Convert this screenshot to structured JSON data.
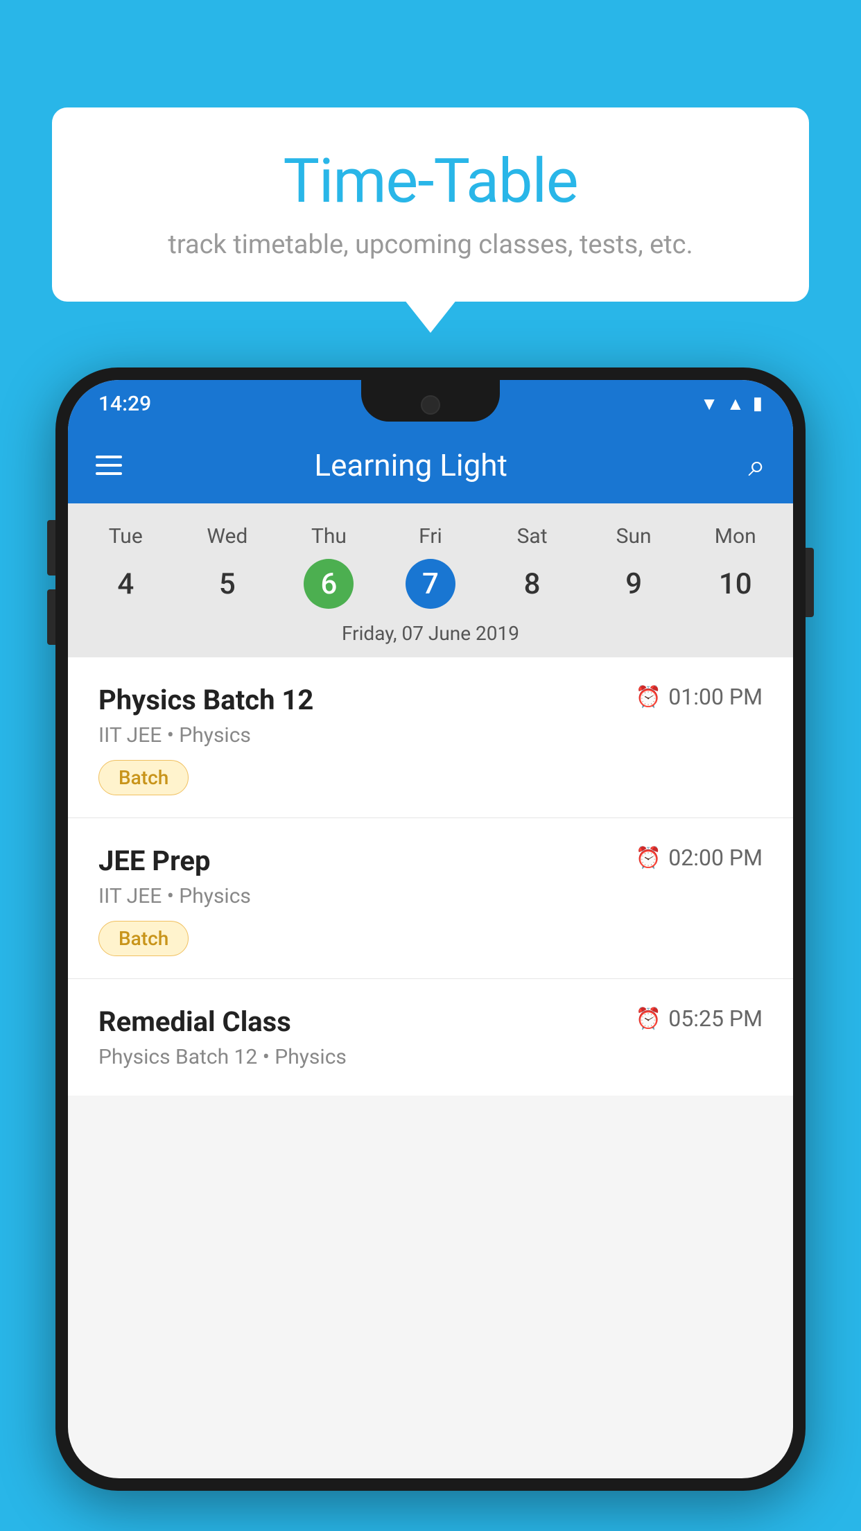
{
  "page": {
    "background_color": "#29b6e8"
  },
  "speech_bubble": {
    "title": "Time-Table",
    "subtitle": "track timetable, upcoming classes, tests, etc."
  },
  "phone": {
    "status_bar": {
      "time": "14:29"
    },
    "app_bar": {
      "title": "Learning Light"
    },
    "calendar": {
      "days": [
        "Tue",
        "Wed",
        "Thu",
        "Fri",
        "Sat",
        "Sun",
        "Mon"
      ],
      "dates": [
        "4",
        "5",
        "6",
        "7",
        "8",
        "9",
        "10"
      ],
      "today_index": 2,
      "selected_index": 3,
      "selected_date_label": "Friday, 07 June 2019"
    },
    "schedule": {
      "items": [
        {
          "title": "Physics Batch 12",
          "time": "01:00 PM",
          "subtitle": "IIT JEE • Physics",
          "tag": "Batch"
        },
        {
          "title": "JEE Prep",
          "time": "02:00 PM",
          "subtitle": "IIT JEE • Physics",
          "tag": "Batch"
        },
        {
          "title": "Remedial Class",
          "time": "05:25 PM",
          "subtitle": "Physics Batch 12 • Physics",
          "tag": null
        }
      ]
    }
  }
}
